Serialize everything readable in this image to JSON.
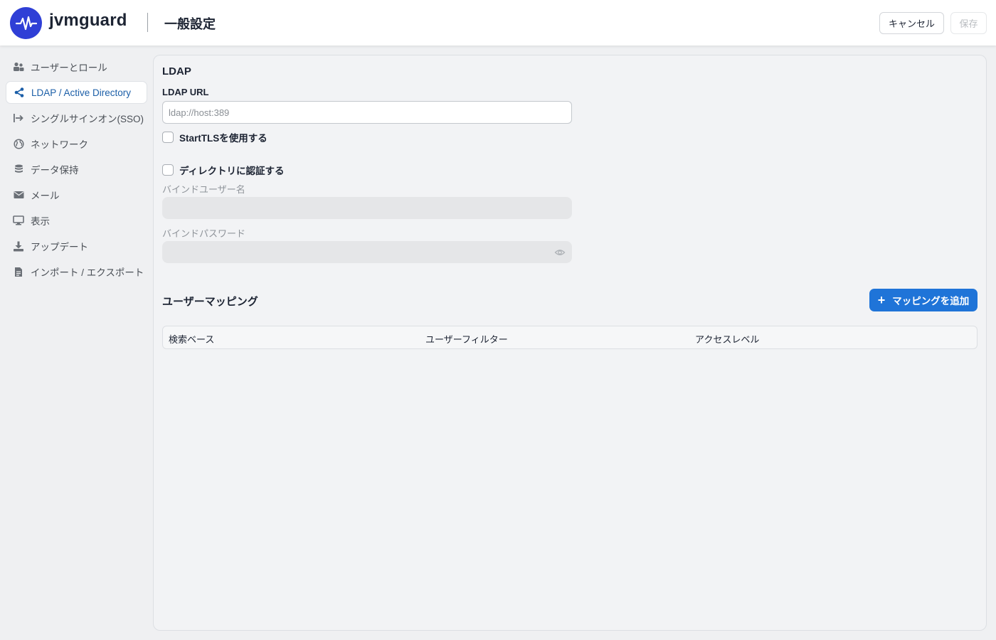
{
  "app": {
    "name": "jvmguard",
    "page_title": "一般設定"
  },
  "header": {
    "cancel_label": "キャンセル",
    "save_label": "保存"
  },
  "sidebar": {
    "items": [
      {
        "label": "ユーザーとロール",
        "icon": "users-icon",
        "active": false
      },
      {
        "label": "LDAP / Active Directory",
        "icon": "share-icon",
        "active": true
      },
      {
        "label": "シングルサインオン(SSO)",
        "icon": "sign-in-icon",
        "active": false
      },
      {
        "label": "ネットワーク",
        "icon": "globe-icon",
        "active": false
      },
      {
        "label": "データ保持",
        "icon": "database-icon",
        "active": false
      },
      {
        "label": "メール",
        "icon": "envelope-icon",
        "active": false
      },
      {
        "label": "表示",
        "icon": "monitor-icon",
        "active": false
      },
      {
        "label": "アップデート",
        "icon": "download-icon",
        "active": false
      },
      {
        "label": "インポート / エクスポート",
        "icon": "file-icon",
        "active": false
      }
    ]
  },
  "ldap": {
    "section_title": "LDAP",
    "url_label": "LDAP URL",
    "url_value": "",
    "url_placeholder": "ldap://host:389",
    "starttls_label": "StartTLSを使用する",
    "starttls_checked": false,
    "auth_label": "ディレクトリに認証する",
    "auth_checked": false,
    "bind_user_label": "バインドユーザー名",
    "bind_user_value": "",
    "bind_password_label": "バインドパスワード",
    "bind_password_value": ""
  },
  "mapping": {
    "title": "ユーザーマッピング",
    "add_button_label": "マッピングを追加",
    "columns": [
      "検索ベース",
      "ユーザーフィルター",
      "アクセスレベル"
    ],
    "rows": []
  },
  "colors": {
    "brand": "#2f3fd6",
    "accent": "#1f74d8",
    "active_nav_text": "#1c5fa8"
  }
}
